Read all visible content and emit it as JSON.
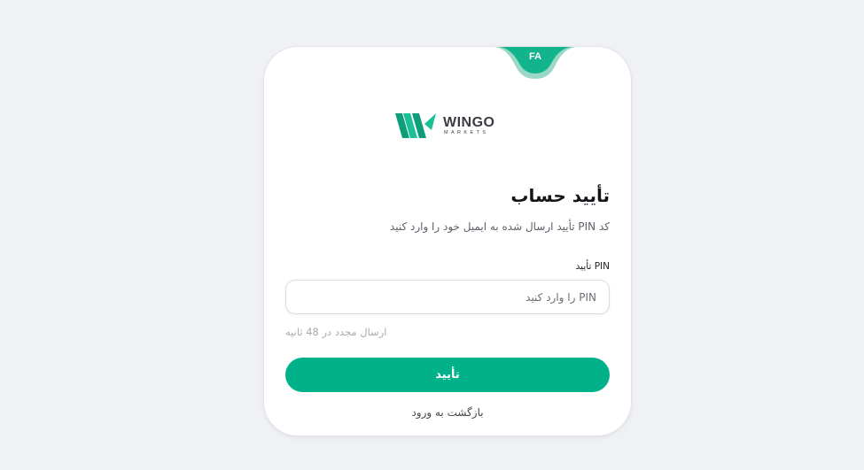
{
  "language_toggle": {
    "label": "FA"
  },
  "logo": {
    "word": "WINGO",
    "sub": "MARKETS",
    "icon": "wingo-logo-icon"
  },
  "heading": {
    "title": "تأیید حساب",
    "subtitle": "کد PIN تأیید ارسال شده به ایمیل خود را وارد کنید"
  },
  "form": {
    "pin_label": "PIN تأیید",
    "pin_placeholder": "PIN را وارد کنید",
    "pin_value": "",
    "resend_text": "ارسال مجدد در 48 ثانیه",
    "confirm_label": "تأیید",
    "back_label": "بازگشت به ورود"
  },
  "colors": {
    "accent": "#00b189",
    "page_bg": "#eff1f5",
    "card_bg": "#ffffff"
  }
}
